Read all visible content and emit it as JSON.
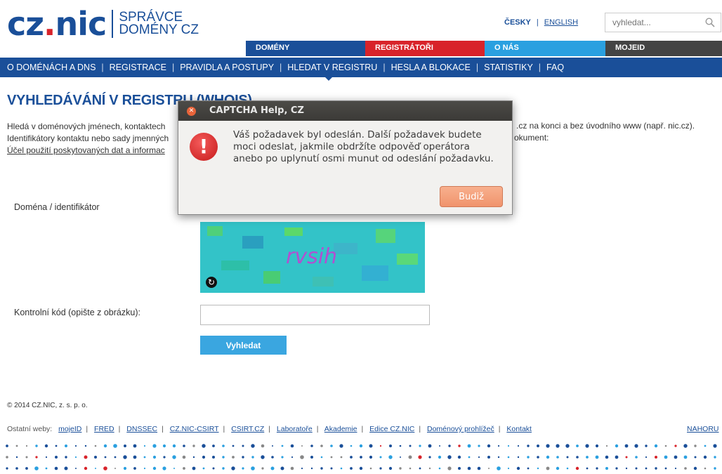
{
  "header": {
    "logo_main": "cz",
    "logo_dot": ".",
    "logo_tail": "nic",
    "logo_sub_1": "SPRÁVCE",
    "logo_sub_2": "DOMÉNY CZ",
    "lang_current": "ČESKY",
    "lang_sep": "|",
    "lang_other": "ENGLISH",
    "search_placeholder": "vyhledat..."
  },
  "topnav": {
    "domeny": "DOMÉNY",
    "registratori": "REGISTRÁTOŘI",
    "o_nas": "O NÁS",
    "mojeid": "MOJEID"
  },
  "subnav": {
    "items": [
      "O DOMÉNÁCH A DNS",
      "REGISTRACE",
      "PRAVIDLA A POSTUPY",
      "HLEDAT V REGISTRU",
      "HESLA A BLOKACE",
      "STATISTIKY",
      "FAQ"
    ],
    "sep": "|"
  },
  "page": {
    "title": "VYHLEDÁVÁNÍ V REGISTRU (WHOIS)",
    "intro_line1": "Hledá v doménových jménech, kontaktech",
    "intro_line2": "Identifikátory kontaktu nebo sady jmenných",
    "intro_link": "Účel použití poskytovaných dat a informac",
    "intro_right1": ".cz na konci a bez úvodního www (např. nic.cz).",
    "intro_right2": "okument:",
    "domain_label": "Doména / identifikátor",
    "captcha_text": "rvsih",
    "code_label": "Kontrolní kód (opište z obrázku):",
    "search_button": "Vyhledat"
  },
  "footer": {
    "copyright": "© 2014 CZ.NIC, z. s. p. o.",
    "other_sites_label": "Ostatní weby:",
    "links": [
      "mojeID",
      "FRED",
      "DNSSEC",
      "CZ.NIC-CSIRT",
      "CSIRT.CZ",
      "Laboratoře",
      "Akademie",
      "Edice CZ.NIC",
      "Doménový prohlížeč",
      "Kontakt"
    ],
    "top_link": "NAHORU"
  },
  "dialog": {
    "title": "CAPTCHA Help, CZ",
    "message_1": "Váš požadavek byl odeslán. Další požadavek budete",
    "message_2": "moci odeslat, jakmile obdržíte odpověď operátora",
    "message_3": "anebo po uplynutí osmi munut od odeslání požadavku.",
    "button": "Budiž"
  },
  "colors": {
    "brand_blue": "#1a4f99",
    "brand_red": "#d8232a",
    "brand_cyan": "#2aa0e0",
    "dialog_button": "#f0936c"
  }
}
